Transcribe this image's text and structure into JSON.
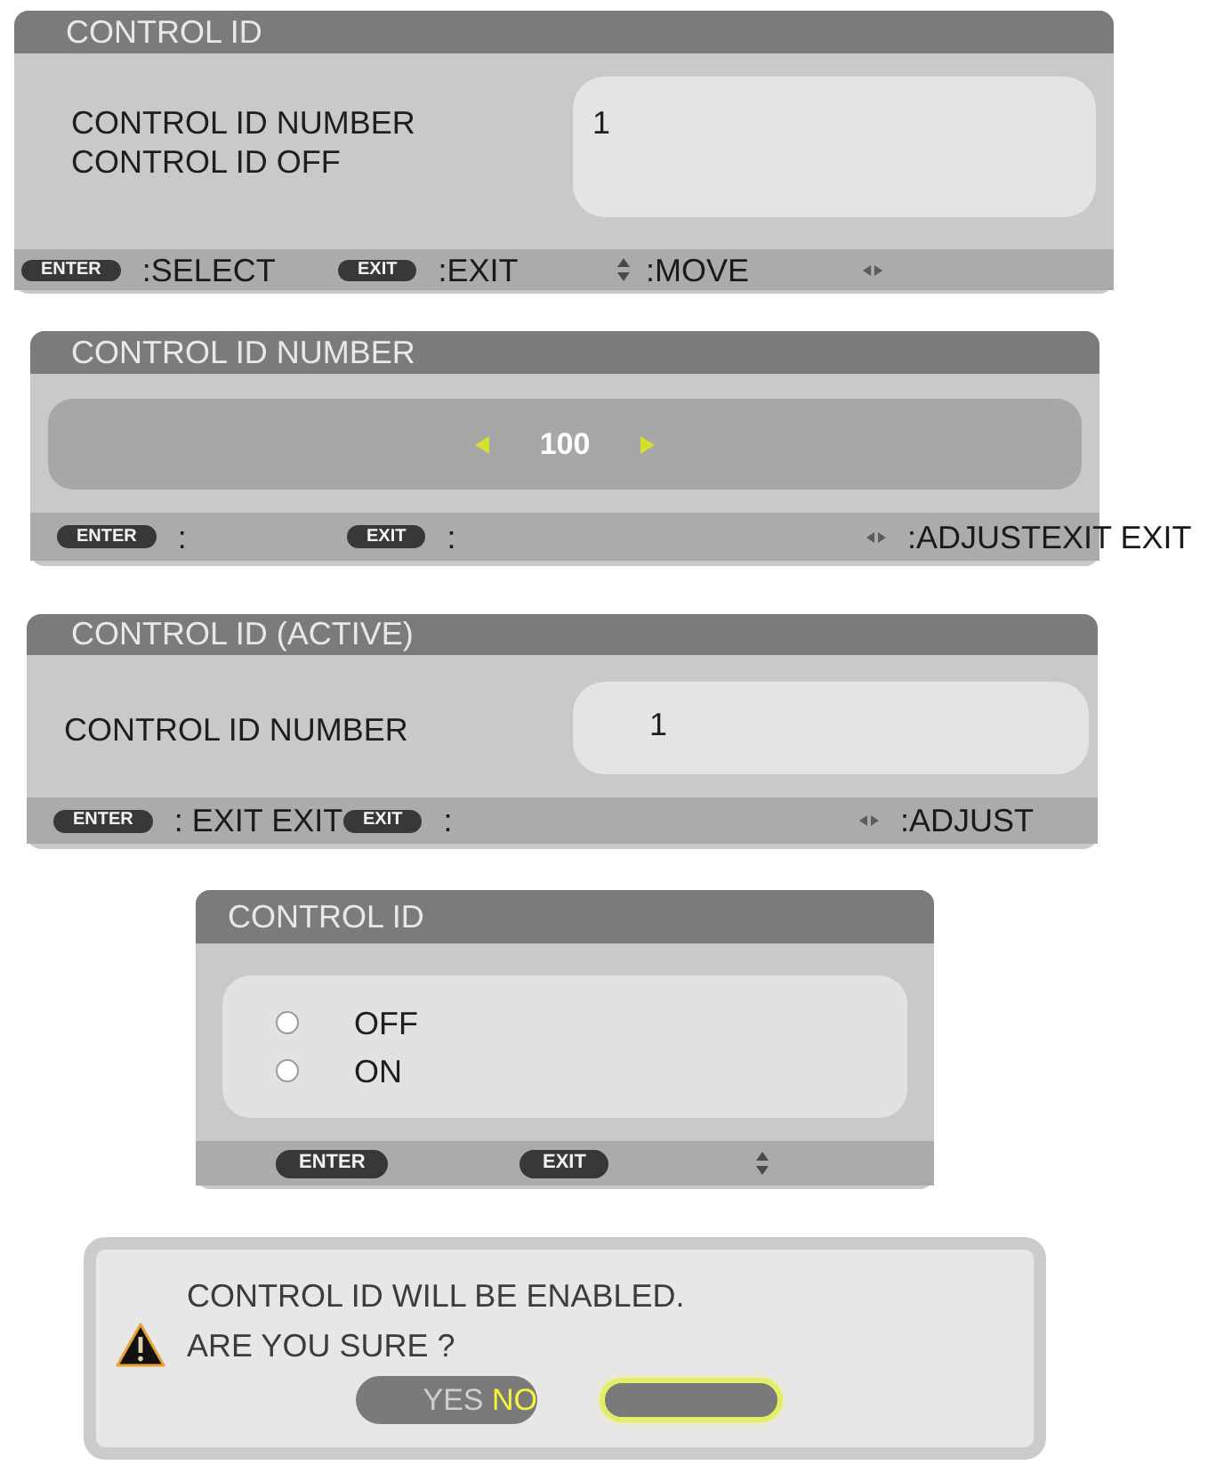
{
  "dialogs": [
    {
      "kind": "value",
      "title": "CONTROL ID",
      "labels": [
        "CONTROL ID NUMBER",
        "CONTROL ID OFF"
      ],
      "value": "1",
      "footer": [
        {
          "kind": "key",
          "label": "ENTER",
          "text": ":SELECT"
        },
        {
          "kind": "key",
          "label": "EXIT",
          "text": ":EXIT"
        },
        {
          "kind": "updown",
          "text": ":MOVE"
        },
        {
          "kind": "leftright"
        }
      ]
    },
    {
      "kind": "adjust",
      "title": "CONTROL ID NUMBER",
      "value": "100",
      "footer": [
        {
          "kind": "key",
          "label": "ENTER",
          "text": ":"
        },
        {
          "kind": "key",
          "label": "EXIT",
          "text": ":"
        },
        {
          "kind": "leftright",
          "text": ":ADJUSTEXIT EXIT"
        }
      ]
    },
    {
      "kind": "value",
      "title": "CONTROL ID (ACTIVE)",
      "labels": [
        "CONTROL ID NUMBER"
      ],
      "value": "1",
      "footer": [
        {
          "kind": "key",
          "label": "ENTER",
          "text": ": EXIT EXIT"
        },
        {
          "kind": "key",
          "label": "EXIT",
          "text": ":"
        },
        {
          "kind": "leftright",
          "text": ":ADJUST"
        }
      ]
    },
    {
      "kind": "radio",
      "title": "CONTROL ID",
      "options": [
        {
          "label": "OFF",
          "selected": false
        },
        {
          "label": "ON",
          "selected": false
        }
      ],
      "footer": [
        {
          "kind": "key",
          "label": "ENTER"
        },
        {
          "kind": "key",
          "label": "EXIT"
        },
        {
          "kind": "updown"
        }
      ]
    },
    {
      "kind": "confirm",
      "lines": [
        "CONTROL ID WILL BE ENABLED.",
        "ARE YOU SURE ?"
      ],
      "buttons": [
        {
          "selected": false,
          "parts": [
            {
              "text": "YES",
              "highlighted": false
            },
            {
              "text": "NO",
              "highlighted": true
            }
          ]
        },
        {
          "selected": true
        }
      ]
    }
  ]
}
